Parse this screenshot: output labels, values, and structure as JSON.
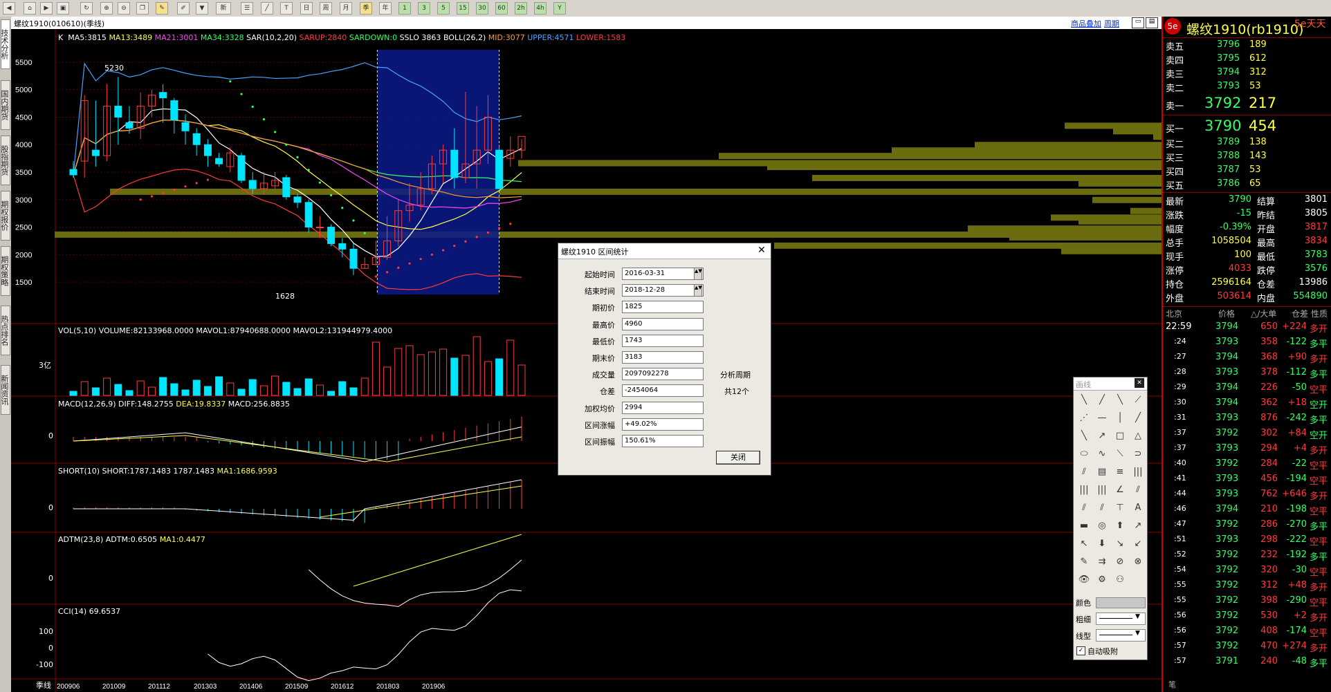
{
  "toolbar": {
    "new_label": "新"
  },
  "left_tabs": [
    "技术分析",
    "国内期货",
    "股指期货",
    "期权报价",
    "期权策略",
    "热点排名",
    "新闻资讯"
  ],
  "header": {
    "symbol_title": "螺纹1910(010610)(季线)",
    "link_overlay": "商品叠加",
    "link_period": "周期"
  },
  "main_indicators": {
    "k": "K",
    "ma5": "MA5:3815",
    "ma13": "MA13:3489",
    "ma21": "MA21:3001",
    "ma34": "MA34:3328",
    "sar": "SAR(10,2,20)",
    "sarup": "SARUP:2840",
    "sardown": "SARDOWN:0",
    "sslo": "SSLO  3863",
    "boll": "BOLL(26,2)",
    "mid": "MID:3077",
    "upper": "UPPER:4571",
    "lower": "LOWER:1583"
  },
  "price_axis": [
    "5500",
    "5000",
    "4500",
    "4000",
    "3500",
    "3000",
    "2500",
    "2000",
    "1500"
  ],
  "price_high_label": "5230",
  "price_low_label": "1628",
  "vol": {
    "title": "VOL(5,10) VOLUME:82133968.0000 MAVOL1:87940688.0000 MAVOL2:131944979.4000",
    "axis": "3亿"
  },
  "macd": {
    "title": "MACD(12,26,9)",
    "diff": "DIFF:148.2755",
    "dea": "DEA:19.8337",
    "macd": "MACD:256.8835",
    "axis": "0"
  },
  "short": {
    "title": "SHORT(10) SHORT:1787.1483 1787.1483",
    "ma": "MA1:1686.9593",
    "axis": "0"
  },
  "adtm": {
    "title": "ADTM(23,8) ADTM:0.6505",
    "ma": "MA1:0.4477",
    "axis": "0"
  },
  "cci": {
    "title": "CCI(14) 69.6537",
    "axis": [
      "100",
      "0",
      "-100"
    ]
  },
  "x_axis": {
    "period": "季线",
    "ticks": [
      "200906",
      "201009",
      "201112",
      "201303",
      "201406",
      "201509",
      "201612",
      "201803",
      "201906"
    ]
  },
  "chart_data": {
    "type": "candlestick",
    "period": "季线",
    "x": [
      "200906",
      "200909",
      "200912",
      "201003",
      "201006",
      "201009",
      "201012",
      "201103",
      "201106",
      "201109",
      "201112",
      "201203",
      "201206",
      "201209",
      "201212",
      "201303",
      "201306",
      "201309",
      "201312",
      "201403",
      "201406",
      "201409",
      "201412",
      "201503",
      "201506",
      "201509",
      "201512",
      "201603",
      "201606",
      "201609",
      "201612",
      "201703",
      "201706",
      "201709",
      "201712",
      "201803",
      "201806",
      "201809",
      "201812",
      "201903",
      "201906"
    ],
    "open": [
      3550,
      3700,
      3900,
      3800,
      4700,
      4400,
      4300,
      4700,
      4950,
      4800,
      4400,
      4200,
      4000,
      3750,
      3600,
      3800,
      3350,
      3200,
      3250,
      3400,
      3050,
      2950,
      2500,
      2500,
      2200,
      2100,
      1750,
      1820,
      1950,
      2250,
      2800,
      2900,
      3200,
      3650,
      3900,
      3400,
      3650,
      3900,
      3900,
      3750,
      3900
    ],
    "high": [
      3700,
      4900,
      4800,
      5100,
      5230,
      4700,
      4950,
      5000,
      5100,
      4850,
      4550,
      4300,
      4100,
      3850,
      3950,
      3850,
      3500,
      3500,
      3500,
      3450,
      3100,
      3000,
      2700,
      2550,
      2300,
      2200,
      1950,
      2250,
      2700,
      3000,
      3300,
      3500,
      3800,
      4000,
      4300,
      4960,
      4700,
      4900,
      4000,
      4150,
      4100
    ],
    "low": [
      3400,
      3400,
      3600,
      3700,
      4000,
      4200,
      4100,
      4500,
      4400,
      4200,
      4000,
      3800,
      3600,
      3600,
      3500,
      3300,
      3100,
      3100,
      3200,
      3000,
      2850,
      2400,
      2300,
      2150,
      1950,
      1628,
      1743,
      1800,
      1900,
      2150,
      2600,
      2800,
      3100,
      3300,
      3200,
      3300,
      3200,
      3650,
      3250,
      3600,
      3750
    ],
    "close": [
      3450,
      4800,
      3800,
      4700,
      4500,
      4300,
      4700,
      4900,
      4850,
      4450,
      4250,
      4000,
      3800,
      3650,
      3850,
      3350,
      3200,
      3300,
      3350,
      3050,
      2950,
      2500,
      2500,
      2200,
      2100,
      1750,
      1820,
      1950,
      2250,
      2800,
      2900,
      3200,
      3650,
      3900,
      3400,
      3650,
      3900,
      4500,
      3200,
      3900,
      4150
    ],
    "ylim": [
      1300,
      5700
    ],
    "annotations": [
      {
        "x": "201103",
        "y": 5230,
        "text": "5230"
      },
      {
        "x": "201509",
        "y": 1628,
        "text": "1628"
      }
    ],
    "series": [
      {
        "name": "MA5",
        "color": "#ffffff"
      },
      {
        "name": "MA13",
        "color": "#ffff44"
      },
      {
        "name": "MA21",
        "color": "#ff44ff"
      },
      {
        "name": "MA34",
        "color": "#33ff66"
      },
      {
        "name": "UPPER",
        "color": "#4aa3ff"
      },
      {
        "name": "MID",
        "color": "#ff9933"
      },
      {
        "name": "LOWER",
        "color": "#ff3b3b"
      }
    ],
    "selected_range": {
      "start": "201603",
      "end": "201812"
    }
  },
  "dialog": {
    "title": "螺纹1910 区间统计",
    "fields": [
      {
        "label": "起始时间",
        "value": "2016-03-31"
      },
      {
        "label": "结束时间",
        "value": "2018-12-28"
      },
      {
        "label": "期初价",
        "value": "1825"
      },
      {
        "label": "最高价",
        "value": "4960"
      },
      {
        "label": "最低价",
        "value": "1743"
      },
      {
        "label": "期末价",
        "value": "3183"
      },
      {
        "label": "成交量",
        "value": "2097092278"
      },
      {
        "label": "仓差",
        "value": "-2454064"
      },
      {
        "label": "加权均价",
        "value": "2994"
      },
      {
        "label": "区间涨幅",
        "value": "+49.02%"
      },
      {
        "label": "区间振幅",
        "value": "150.61%"
      }
    ],
    "period_label": "分析周期",
    "period_value": "共12个",
    "close_button": "关闭"
  },
  "palette": {
    "title": "画线",
    "color_label": "颜色",
    "width_label": "粗细",
    "style_label": "线型",
    "auto_snap_label": "自动吸附"
  },
  "right_panel": {
    "title": "螺纹1910(rb1910)",
    "brand": "5e天天",
    "asks": [
      {
        "label": "卖五",
        "price": "3796",
        "vol": "189"
      },
      {
        "label": "卖四",
        "price": "3795",
        "vol": "612"
      },
      {
        "label": "卖三",
        "price": "3794",
        "vol": "312"
      },
      {
        "label": "卖二",
        "price": "3793",
        "vol": "53"
      },
      {
        "label": "卖一",
        "price": "3792",
        "vol": "217"
      }
    ],
    "bids": [
      {
        "label": "买一",
        "price": "3790",
        "vol": "454"
      },
      {
        "label": "买二",
        "price": "3789",
        "vol": "138"
      },
      {
        "label": "买三",
        "price": "3788",
        "vol": "143"
      },
      {
        "label": "买四",
        "price": "3787",
        "vol": "53"
      },
      {
        "label": "买五",
        "price": "3786",
        "vol": "65"
      }
    ],
    "stats": [
      {
        "l1": "最新",
        "v1": "3790",
        "l2": "结算",
        "v2": "3801"
      },
      {
        "l1": "涨跌",
        "v1": "-15",
        "l2": "昨结",
        "v2": "3805"
      },
      {
        "l1": "幅度",
        "v1": "-0.39%",
        "l2": "开盘",
        "v2": "3817"
      },
      {
        "l1": "总手",
        "v1": "1058504",
        "l2": "最高",
        "v2": "3834"
      },
      {
        "l1": "现手",
        "v1": "100",
        "l2": "最低",
        "v2": "3783"
      },
      {
        "l1": "涨停",
        "v1": "4033",
        "l2": "跌停",
        "v2": "3576"
      },
      {
        "l1": "持仓",
        "v1": "2596164",
        "l2": "仓差",
        "v2": "13986"
      },
      {
        "l1": "外盘",
        "v1": "503614",
        "l2": "内盘",
        "v2": "554890"
      }
    ],
    "ticks_header": {
      "c1": "北京",
      "c2": "价格",
      "c3": "△/大单",
      "c4": "仓差",
      "c5": "性质"
    },
    "ticks": [
      {
        "t": "22:59",
        "p": "3794",
        "v": "650",
        "d": "+224",
        "n": "多开"
      },
      {
        "t": ":24",
        "p": "3793",
        "v": "358",
        "d": "-122",
        "n": "多平"
      },
      {
        "t": ":27",
        "p": "3794",
        "v": "368",
        "d": "+90",
        "n": "多开"
      },
      {
        "t": ":28",
        "p": "3793",
        "v": "378",
        "d": "-112",
        "n": "多平"
      },
      {
        "t": ":29",
        "p": "3794",
        "v": "226",
        "d": "-50",
        "n": "空平"
      },
      {
        "t": ":30",
        "p": "3794",
        "v": "362",
        "d": "+18",
        "n": "空开"
      },
      {
        "t": ":31",
        "p": "3793",
        "v": "876",
        "d": "-242",
        "n": "多平"
      },
      {
        "t": ":37",
        "p": "3792",
        "v": "302",
        "d": "+84",
        "n": "空开"
      },
      {
        "t": ":37",
        "p": "3793",
        "v": "294",
        "d": "+4",
        "n": "多开"
      },
      {
        "t": ":40",
        "p": "3792",
        "v": "284",
        "d": "-22",
        "n": "空平"
      },
      {
        "t": ":41",
        "p": "3793",
        "v": "456",
        "d": "-194",
        "n": "空平"
      },
      {
        "t": ":44",
        "p": "3793",
        "v": "762",
        "d": "+646",
        "n": "多开"
      },
      {
        "t": ":46",
        "p": "3794",
        "v": "210",
        "d": "-198",
        "n": "空平"
      },
      {
        "t": ":47",
        "p": "3792",
        "v": "286",
        "d": "-270",
        "n": "多平"
      },
      {
        "t": ":51",
        "p": "3793",
        "v": "298",
        "d": "-222",
        "n": "空平"
      },
      {
        "t": ":52",
        "p": "3792",
        "v": "232",
        "d": "-192",
        "n": "多平"
      },
      {
        "t": ":54",
        "p": "3792",
        "v": "320",
        "d": "-30",
        "n": "空平"
      },
      {
        "t": ":55",
        "p": "3792",
        "v": "312",
        "d": "+48",
        "n": "多开"
      },
      {
        "t": ":55",
        "p": "3792",
        "v": "398",
        "d": "-290",
        "n": "空平"
      },
      {
        "t": ":56",
        "p": "3792",
        "v": "530",
        "d": "+2",
        "n": "多开"
      },
      {
        "t": ":56",
        "p": "3792",
        "v": "408",
        "d": "-174",
        "n": "空平"
      },
      {
        "t": ":57",
        "p": "3792",
        "v": "470",
        "d": "+274",
        "n": "多开"
      },
      {
        "t": ":57",
        "p": "3791",
        "v": "240",
        "d": "-48",
        "n": "多平"
      }
    ],
    "footer": "笔"
  },
  "colors": {
    "up": "#ff3b3b",
    "down": "#00e5ff",
    "grid": "#8b0000",
    "volume_profile": "#6b6b10",
    "selection": "#0a1a8a"
  }
}
